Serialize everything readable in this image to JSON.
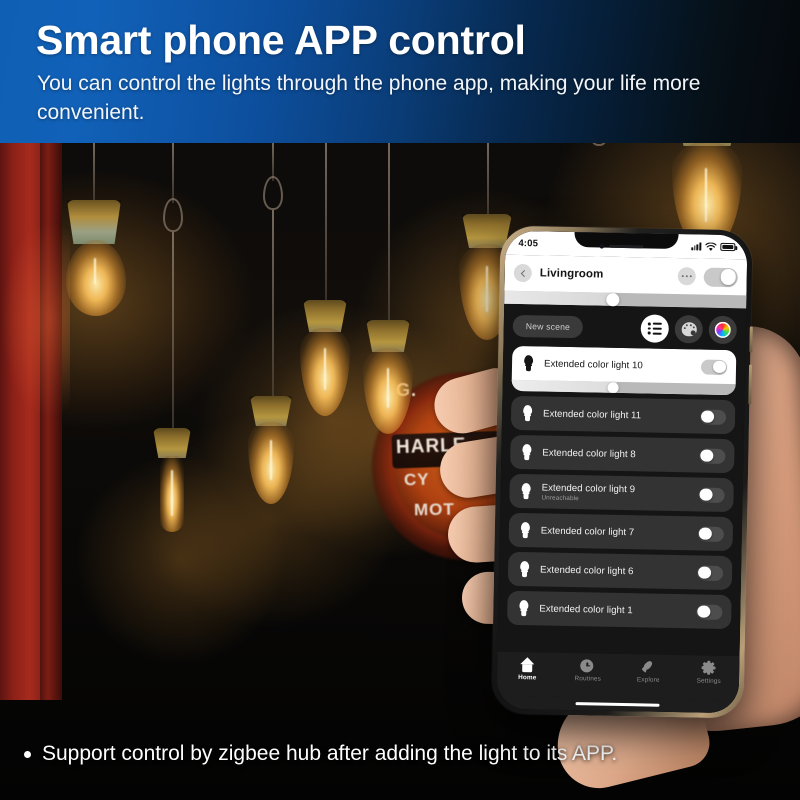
{
  "banner": {
    "title": "Smart phone APP control",
    "subtitle": "You can control the lights through the phone app, making your life more convenient."
  },
  "caption": {
    "bullet_text": "Support control by zigbee hub after adding the light to its APP."
  },
  "phone": {
    "status_bar": {
      "time": "4:05",
      "signal_icon": "cellular-bars-icon",
      "wifi_icon": "wifi-icon",
      "battery_icon": "battery-full-icon"
    },
    "header": {
      "back_icon": "chevron-left-icon",
      "room_name": "Livingroom",
      "overflow_icon": "more-horizontal-icon",
      "master_toggle_state": "on",
      "brightness_percent": 46
    },
    "toolbar": {
      "new_scene_label": "New scene",
      "list_view_icon": "list-view-icon",
      "palette_icon": "color-palette-icon",
      "color-wheel_icon": "color-wheel-icon"
    },
    "lights": [
      {
        "name": "Extended color light 10",
        "status": "",
        "toggle": "on",
        "active": true,
        "brightness_percent": 47
      },
      {
        "name": "Extended color light 11",
        "status": "",
        "toggle": "off",
        "active": false
      },
      {
        "name": "Extended color light 8",
        "status": "",
        "toggle": "off",
        "active": false
      },
      {
        "name": "Extended color light 9",
        "status": "Unreachable",
        "toggle": "off",
        "active": false
      },
      {
        "name": "Extended color light 7",
        "status": "",
        "toggle": "off",
        "active": false
      },
      {
        "name": "Extended color light 6",
        "status": "",
        "toggle": "off",
        "active": false
      },
      {
        "name": "Extended color light 1",
        "status": "",
        "toggle": "off",
        "active": false
      }
    ],
    "tabbar": [
      {
        "label": "Home",
        "icon": "home-icon",
        "selected": true
      },
      {
        "label": "Routines",
        "icon": "clock-icon",
        "selected": false
      },
      {
        "label": "Explore",
        "icon": "rocket-icon",
        "selected": false
      },
      {
        "label": "Settings",
        "icon": "gear-icon",
        "selected": false
      }
    ]
  },
  "background": {
    "sign_text_top": "G.",
    "sign_text_1": "HARLE",
    "sign_text_2": "CY",
    "sign_text_3": "MOT"
  },
  "colors": {
    "banner_blue": "#0f5fb5",
    "card_dark": "#333333",
    "card_active": "#ffffff",
    "screen_bg": "#151515",
    "bulb_glow": "#ffc45c"
  }
}
